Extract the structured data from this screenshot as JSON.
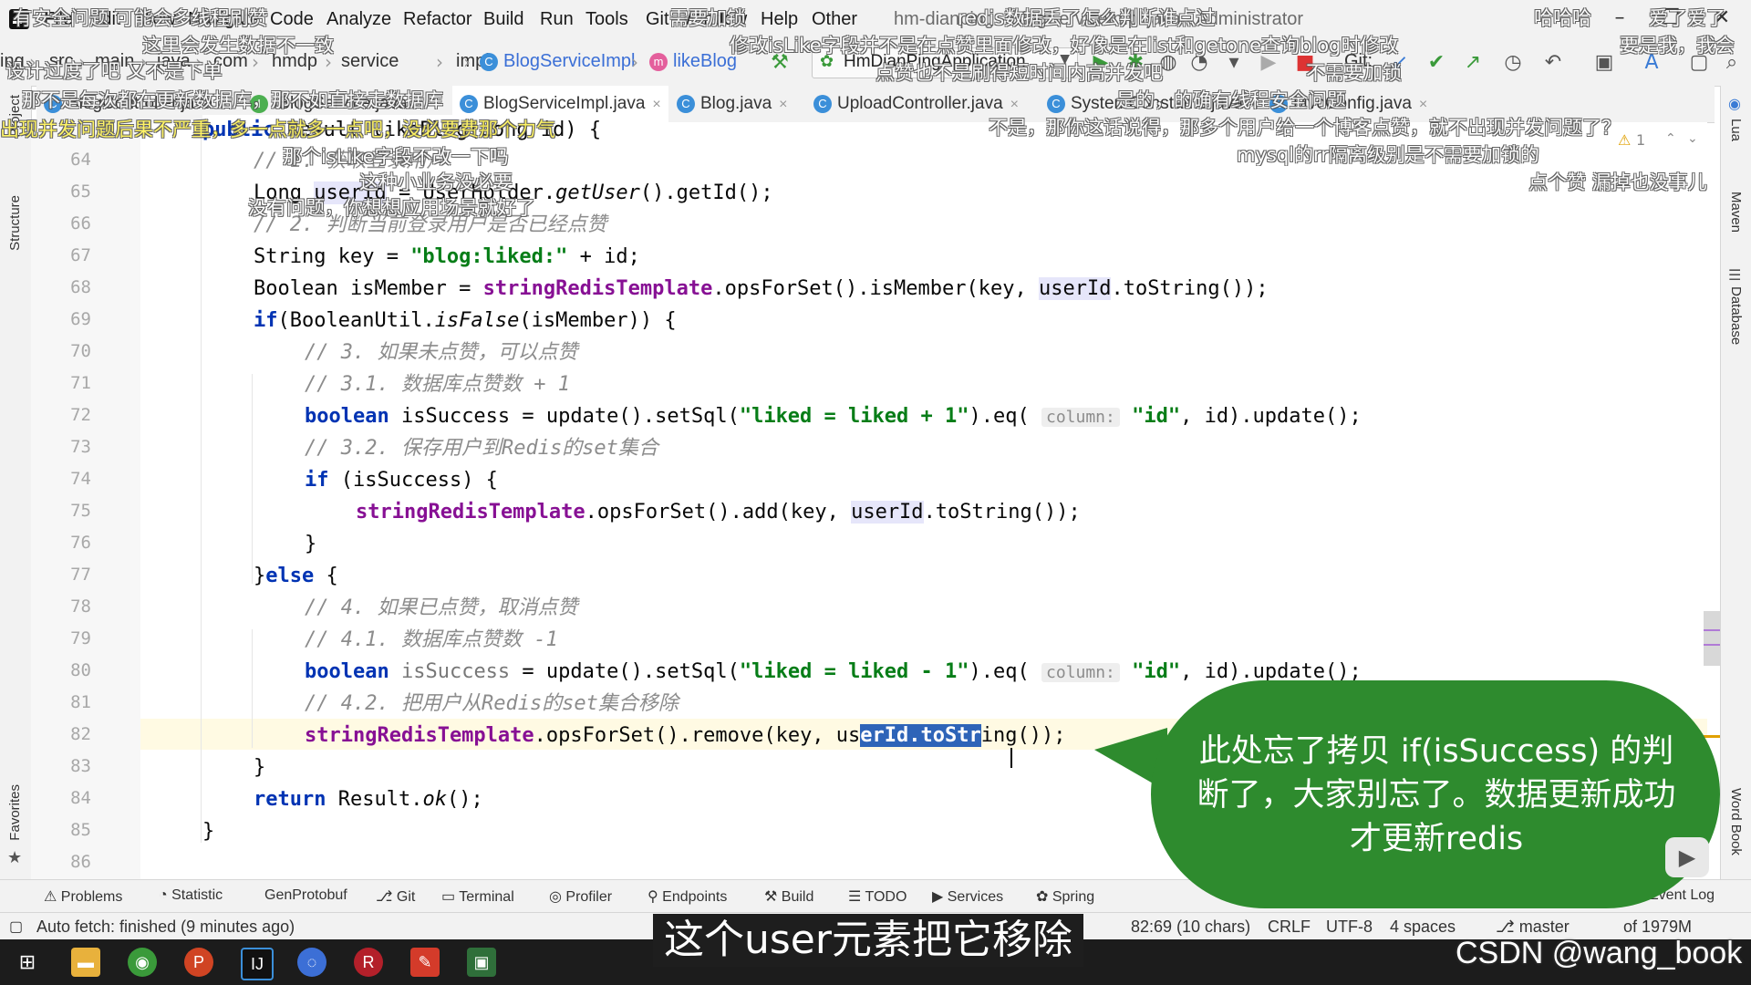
{
  "menu": {
    "items": [
      "File",
      "Edit",
      "View",
      "Navigate",
      "Code",
      "Analyze",
      "Refactor",
      "Build",
      "Run",
      "Tools",
      "Git",
      "Window",
      "Help",
      "Other"
    ],
    "title": "hm-dianping - BlogServiceImpl.java - Administrator"
  },
  "breadcrumb": [
    "ing",
    "src",
    "main",
    "java",
    "com",
    "hmdp",
    "service",
    "impl",
    "BlogServiceImpl",
    "likeBlog"
  ],
  "run_config": "HmDianPingApplication",
  "git_label": "Git:",
  "tabs": [
    {
      "label": "BlogController.java",
      "icon": "class-icon"
    },
    {
      "label": "IBlogService.java",
      "icon": "interface-icon"
    },
    {
      "label": "BlogServiceImpl.java",
      "icon": "class-icon",
      "active": true
    },
    {
      "label": "Blog.java",
      "icon": "class-icon"
    },
    {
      "label": "UploadController.java",
      "icon": "class-icon"
    },
    {
      "label": "SystemConstants.java",
      "icon": "class-icon"
    },
    {
      "label": "MvcConfig.java",
      "icon": "class-icon"
    }
  ],
  "left_tools": [
    "Project",
    "Structure",
    "Favorites"
  ],
  "right_tools": [
    "Lua",
    "Maven",
    "Database",
    "Word Book"
  ],
  "warning_count": "1",
  "editor": {
    "sticky_header": "public Result likeBlog(Long id) {",
    "line_numbers": [
      "64",
      "65",
      "66",
      "67",
      "68",
      "69",
      "70",
      "71",
      "72",
      "73",
      "74",
      "75",
      "76",
      "77",
      "78",
      "79",
      "80",
      "81",
      "82",
      "83",
      "84",
      "85",
      "86"
    ],
    "comments": {
      "l64": "// 1. 获取登录用户",
      "l66": "// 2. 判断当前登录用户是否已经点赞",
      "l70": "// 3. 如果未点赞，可以点赞",
      "l71": "// 3.1. 数据库点赞数 + 1",
      "l73": "// 3.2. 保存用户到Redis的set集合",
      "l78": "// 4. 如果已点赞，取消点赞",
      "l79": "// 4.1. 数据库点赞数 -1",
      "l81": "// 4.2. 把用户从Redis的set集合移除"
    },
    "strings": {
      "key_prefix": "\"blog:liked:\"",
      "sql_inc": "\"liked = liked + 1\"",
      "sql_dec": "\"liked = liked - 1\"",
      "id_col": "\"id\""
    },
    "param_hint": "column:"
  },
  "bottom_tools": [
    "Problems",
    "Statistic",
    "GenProtobuf",
    "Git",
    "Terminal",
    "Profiler",
    "Endpoints",
    "Build",
    "TODO",
    "Services",
    "Spring",
    "Event Log"
  ],
  "status": {
    "fetch": "Auto fetch: finished (9 minutes ago)",
    "position": "82:69 (10 chars)",
    "line_sep": "CRLF",
    "encoding": "UTF-8",
    "indent": "4 spaces",
    "branch": "master",
    "memory": "of 1979M"
  },
  "bubble_text": "此处忘了拷贝 if(isSuccess) 的判断了，大家别忘了。数据更新成功才更新redis",
  "subtitle": "这个user元素把它移除",
  "watermark": "CSDN @wang_book",
  "danmaku": [
    "有安全问题 可能会多线程刷赞",
    "这里会发生数据不一致",
    "设计过度了吧 又不是下单",
    "那不是每次都在更新数据库，那不如直接走数据库",
    "出现并发问题后果不严重，多一点就多一点吧，没必要费那个力气",
    "那个isLike字段不改一下吗",
    "这种小业务没必要",
    "没有问题，你想想应用场景就好了",
    "redis数据丢了怎么判断谁点过",
    "修改isLike字段并不是在点赞里面修改，好像是在list和getone查询blog时修改",
    "点赞也不是刷得短时间内高并发吧",
    "不需要加锁",
    "是的，的确有线程安全问题",
    "不是，那你这话说得，那多个用户给一个博客点赞，就不出现并发问题了？",
    "mysql的rr隔离级别是不需要加锁的",
    "点个赞 漏掉也没事儿",
    "哈哈哈",
    "爱了爱了",
    "要是我，我会",
    "需要加锁"
  ]
}
